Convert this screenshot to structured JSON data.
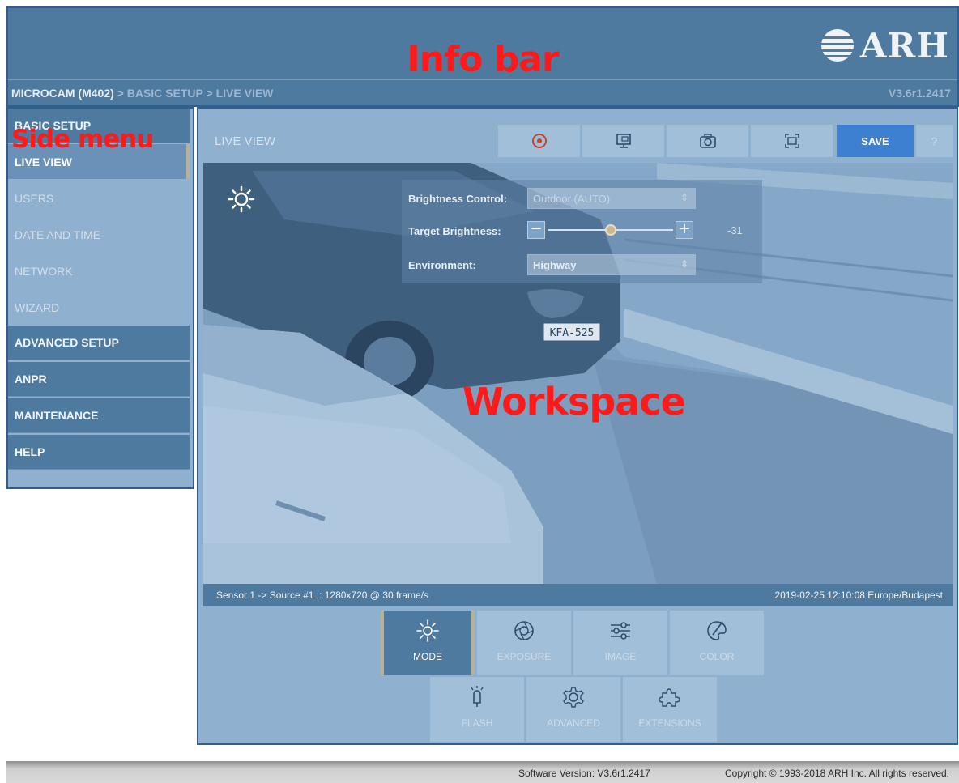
{
  "annotations": {
    "info_bar": "Info bar",
    "side_menu": "Side menu",
    "workspace": "Workspace"
  },
  "header": {
    "logo_text": "ARH",
    "breadcrumb": {
      "device": "MICROCAM (M402)",
      "separator": ">",
      "section": "BASIC SETUP",
      "page": "LIVE VIEW"
    },
    "version": "V3.6r1.2417"
  },
  "sidebar": {
    "items": [
      {
        "label": "BASIC SETUP",
        "kind": "header"
      },
      {
        "label": "LIVE VIEW",
        "kind": "active"
      },
      {
        "label": "USERS",
        "kind": "sub"
      },
      {
        "label": "DATE AND TIME",
        "kind": "sub"
      },
      {
        "label": "NETWORK",
        "kind": "sub"
      },
      {
        "label": "WIZARD",
        "kind": "sub"
      },
      {
        "label": "ADVANCED SETUP",
        "kind": "header"
      },
      {
        "label": "ANPR",
        "kind": "header"
      },
      {
        "label": "MAINTENANCE",
        "kind": "header"
      },
      {
        "label": "HELP",
        "kind": "header"
      }
    ]
  },
  "toolbar": {
    "title": "LIVE VIEW",
    "icons": [
      "record-icon",
      "display-icon",
      "camera-icon",
      "fullscreen-icon"
    ],
    "save_label": "SAVE",
    "help_label": "?"
  },
  "overlay": {
    "brightness_control_label": "Brightness Control:",
    "brightness_control_value": "Outdoor (AUTO)",
    "target_brightness_label": "Target Brightness:",
    "target_brightness_value": "-31",
    "target_brightness_fraction": 0.5,
    "environment_label": "Environment:",
    "environment_value": "Highway",
    "minus_label": "−",
    "plus_label": "+",
    "select_arrow": "⇕"
  },
  "camera": {
    "plate_text": "KFA-525"
  },
  "status": {
    "left": "Sensor 1 -> Source #1 :: 1280x720 @ 30 frame/s",
    "right": "2019-02-25 12:10:08 Europe/Budapest"
  },
  "modes": {
    "row1": [
      {
        "label": "MODE",
        "icon": "brightness-icon",
        "active": true
      },
      {
        "label": "EXPOSURE",
        "icon": "aperture-icon",
        "active": false
      },
      {
        "label": "IMAGE",
        "icon": "sliders-icon",
        "active": false
      },
      {
        "label": "COLOR",
        "icon": "palette-icon",
        "active": false
      }
    ],
    "row2": [
      {
        "label": "FLASH",
        "icon": "flash-icon",
        "active": false
      },
      {
        "label": "ADVANCED",
        "icon": "gear-icon",
        "active": false
      },
      {
        "label": "EXTENSIONS",
        "icon": "puzzle-icon",
        "active": false
      }
    ]
  },
  "footer": {
    "software_version": "Software Version:  V3.6r1.2417",
    "copyright": "Copyright © 1993-2018 ARH Inc. All rights reserved."
  }
}
